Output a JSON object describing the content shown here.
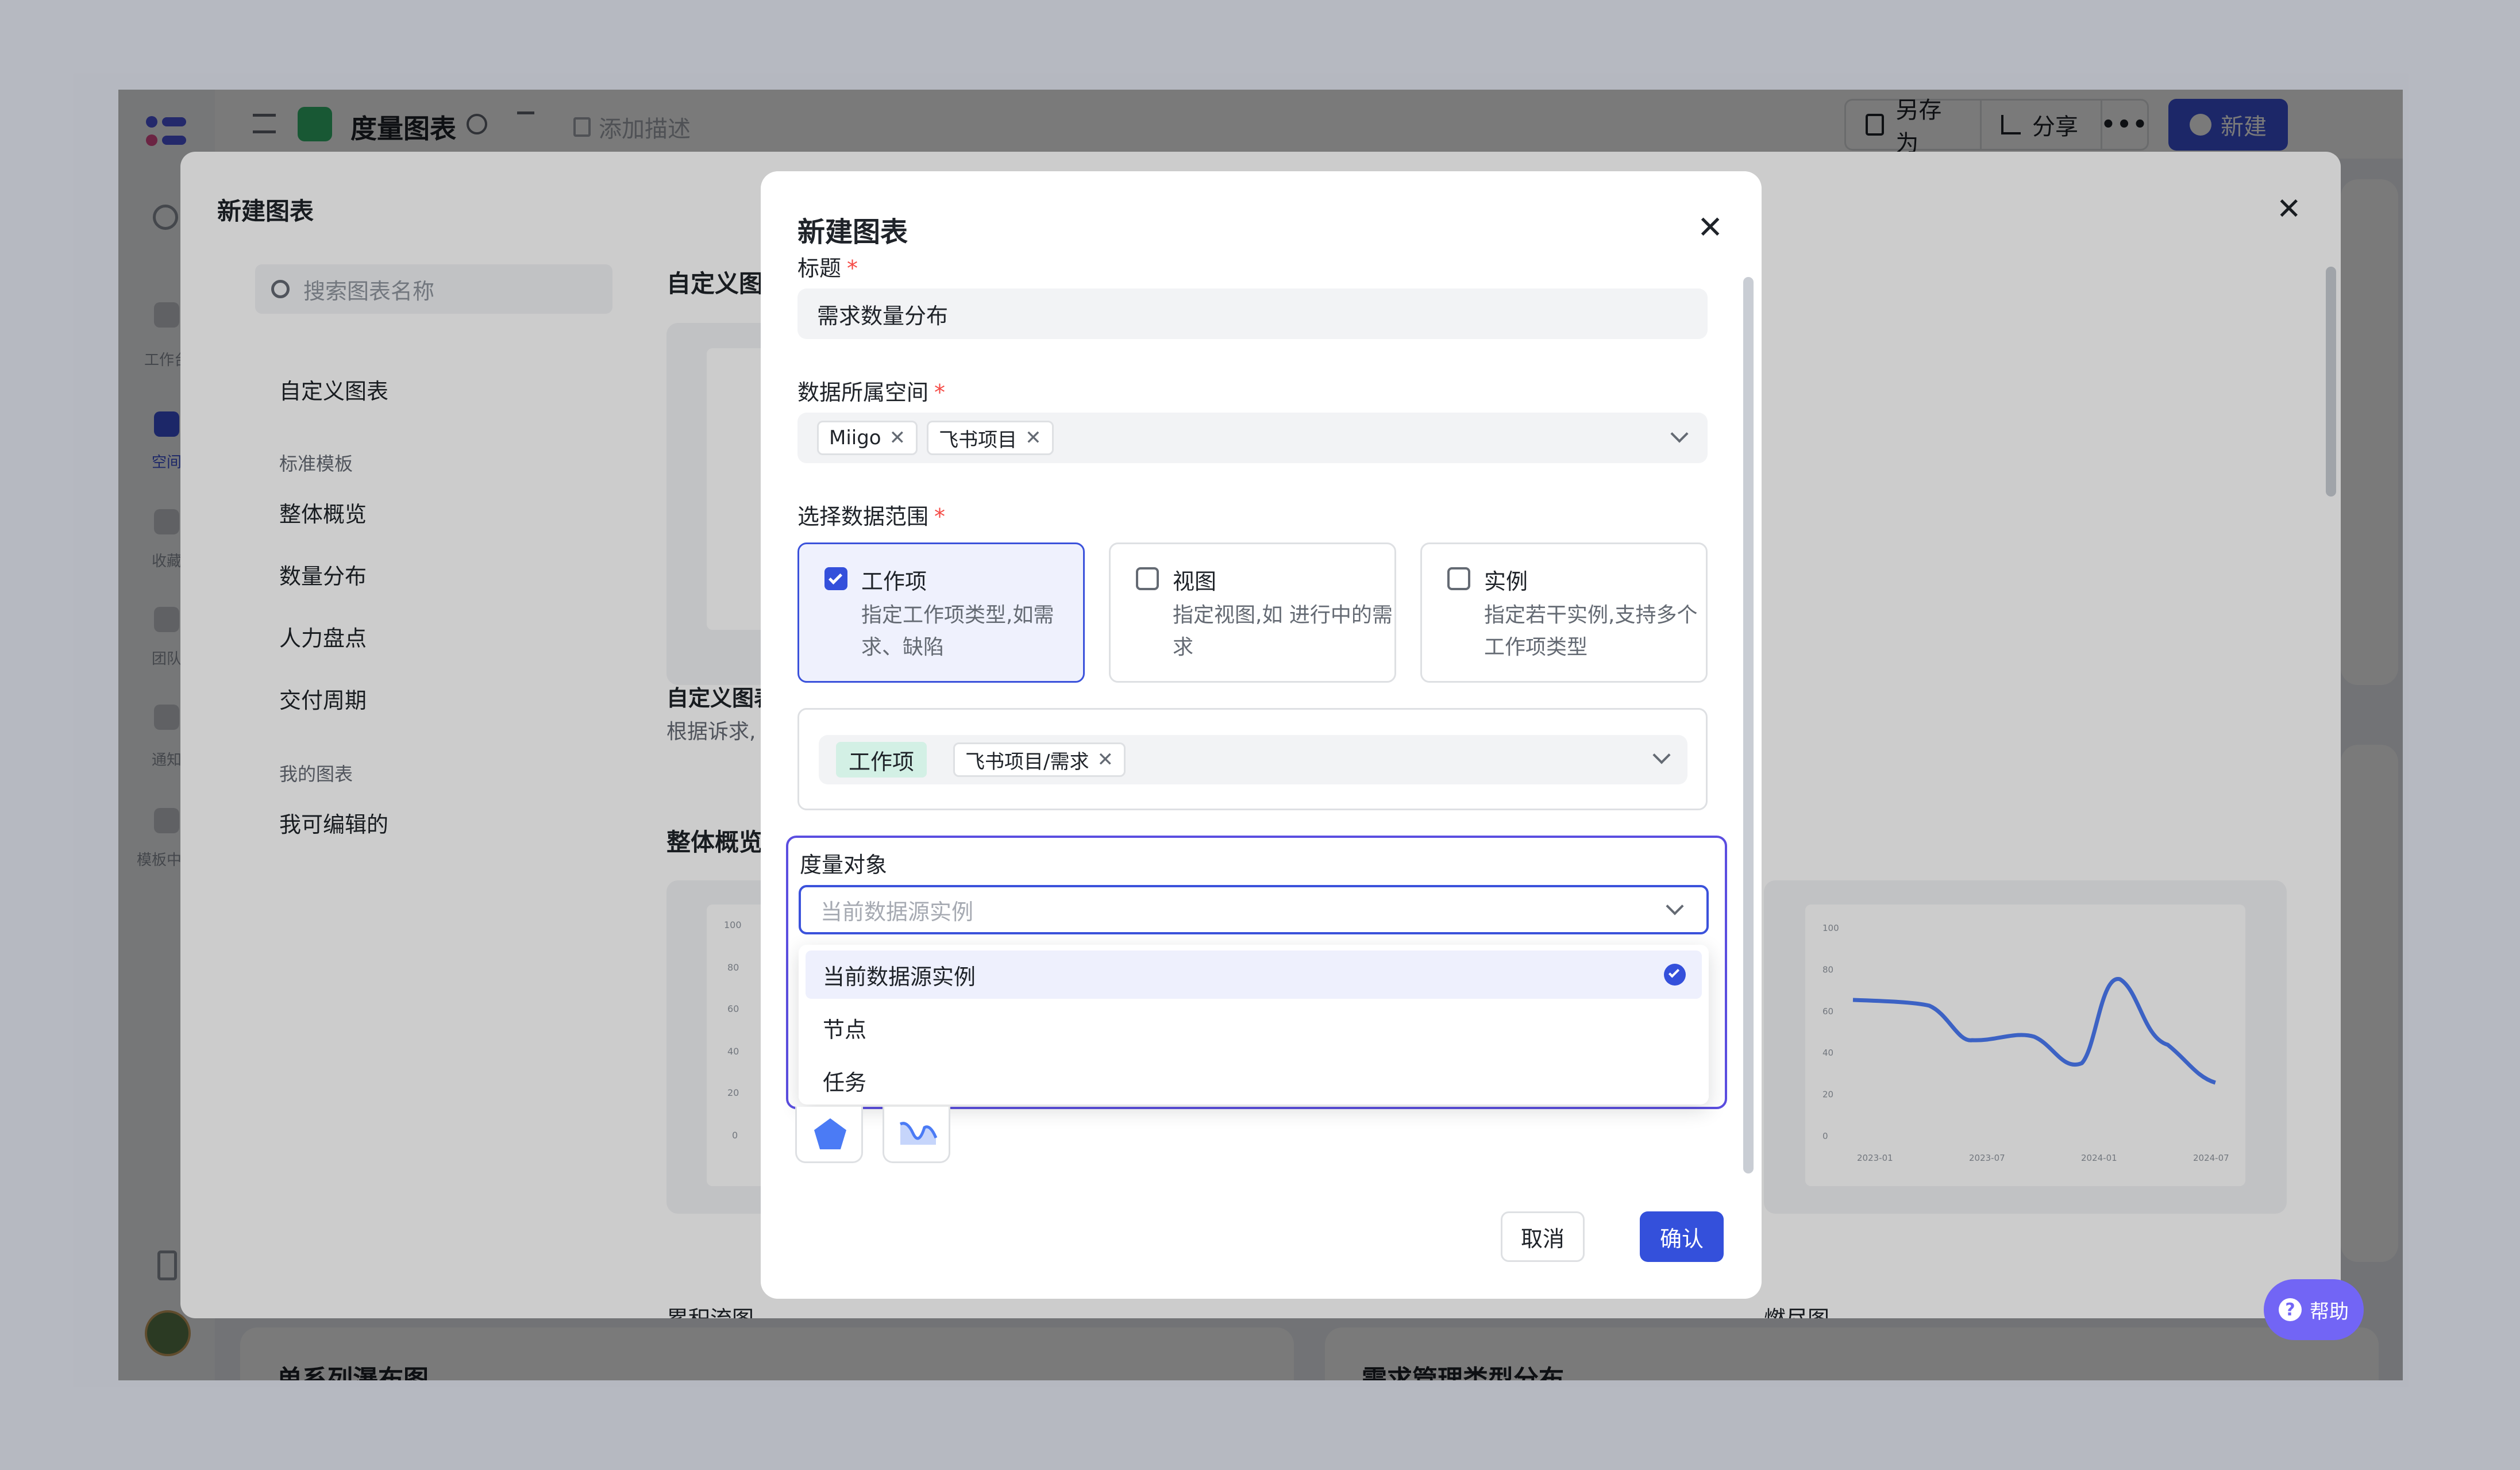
{
  "app": {
    "title": "度量图表",
    "add_description": "添加描述",
    "save_as": "另存为",
    "share": "分享",
    "new": "新建",
    "sidebar": [
      "工作台",
      "空间",
      "收藏",
      "团队",
      "通知",
      "模板中心"
    ],
    "background_sections": [
      "单系列瀑布图",
      "需求管理类型分布"
    ]
  },
  "picker": {
    "title": "新建图表",
    "search_placeholder": "搜索图表名称",
    "nav": {
      "custom": "自定义图表",
      "group_standard": "标准模板",
      "overview": "整体概览",
      "distribution": "数量分布",
      "manpower": "人力盘点",
      "delivery": "交付周期",
      "group_mine": "我的图表",
      "editable": "我可编辑的"
    },
    "section_custom": "自定义图",
    "custom_card_title": "自定义图表",
    "custom_card_desc": "根据诉求,",
    "section_overview": "整体概览",
    "card_cfd": "累积流图",
    "card_burndown": "燃尽图",
    "line_chart": {
      "y_ticks": [
        "100",
        "80",
        "60",
        "40",
        "20",
        "0"
      ],
      "x_ticks": [
        "2023-01",
        "2023-07",
        "2024-01",
        "2024-07"
      ]
    }
  },
  "form": {
    "title": "新建图表",
    "title_label": "标题",
    "title_value": "需求数量分布",
    "space_label": "数据所属空间",
    "space_tags": [
      "Miigo",
      "飞书项目"
    ],
    "range_label": "选择数据范围",
    "range_options": [
      {
        "name": "工作项",
        "desc": "指定工作项类型,如需求、缺陷",
        "checked": true
      },
      {
        "name": "视图",
        "desc": "指定视图,如 进行中的需求",
        "checked": false
      },
      {
        "name": "实例",
        "desc": "指定若干实例,支持多个工作项类型",
        "checked": false
      }
    ],
    "workitem_chip": "工作项",
    "workitem_tag": "飞书项目/需求",
    "measure_label": "度量对象",
    "measure_placeholder": "当前数据源实例",
    "measure_options": [
      "当前数据源实例",
      "节点",
      "任务"
    ],
    "cancel": "取消",
    "confirm": "确认"
  },
  "help": "帮助",
  "colors": {
    "primary": "#3450db",
    "focus": "#5b4ee0",
    "required": "#f54a45",
    "chart_line": "#4b7bf5"
  }
}
